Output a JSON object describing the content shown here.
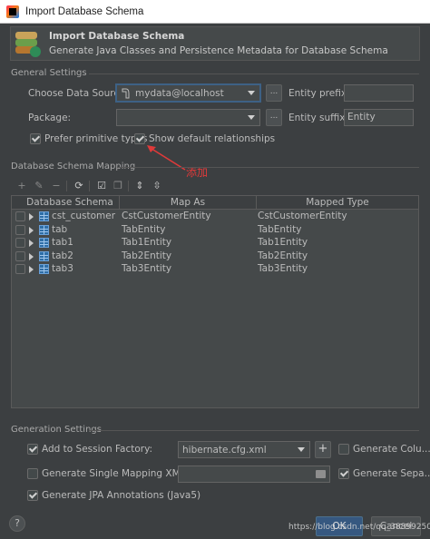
{
  "window": {
    "title": "Import Database Schema"
  },
  "banner": {
    "title": "Import Database Schema",
    "subtitle": "Generate Java Classes and Persistence Metadata for Database Schema"
  },
  "general": {
    "section_label": "General Settings",
    "datasource_label": "Choose Data Source:",
    "datasource_value": "mydata@localhost",
    "package_label": "Package:",
    "package_value": "",
    "browse_label": "...",
    "entity_prefix_label": "Entity prefix:",
    "entity_prefix_value": "",
    "entity_suffix_label": "Entity suffix:",
    "entity_suffix_value": "Entity",
    "prefer_primitive_label": "Prefer primitive types",
    "prefer_primitive_checked": true,
    "show_default_rel_label": "Show default relationships",
    "show_default_rel_checked": true
  },
  "annotation": {
    "text": "添加",
    "color": "#e03a3a"
  },
  "mapping": {
    "section_label": "Database Schema Mapping",
    "toolbar": [
      "add-icon",
      "edit-icon",
      "remove-icon",
      "refresh-icon",
      "check-all-icon",
      "copy-icon",
      "expand-all-icon",
      "collapse-all-icon"
    ],
    "columns": [
      "Database Schema",
      "Map As",
      "Mapped Type"
    ],
    "rows": [
      {
        "schema": "cst_customer",
        "map_as": "CstCustomerEntity",
        "mapped_type": "CstCustomerEntity"
      },
      {
        "schema": "tab",
        "map_as": "TabEntity",
        "mapped_type": "TabEntity"
      },
      {
        "schema": "tab1",
        "map_as": "Tab1Entity",
        "mapped_type": "Tab1Entity"
      },
      {
        "schema": "tab2",
        "map_as": "Tab2Entity",
        "mapped_type": "Tab2Entity"
      },
      {
        "schema": "tab3",
        "map_as": "Tab3Entity",
        "mapped_type": "Tab3Entity"
      }
    ]
  },
  "generation": {
    "section_label": "Generation Settings",
    "add_session_label": "Add to Session Factory:",
    "add_session_checked": true,
    "session_factory_value": "hibernate.cfg.xml",
    "add_button": "+",
    "generate_columns_label": "Generate Colu...",
    "generate_columns_checked": false,
    "single_mapping_label": "Generate Single Mapping XML:",
    "single_mapping_checked": false,
    "single_mapping_value": "",
    "generate_separate_label": "Generate Sepa...",
    "generate_separate_checked": true,
    "jpa_label": "Generate JPA Annotations (Java5)",
    "jpa_checked": true
  },
  "footer": {
    "help": "?",
    "ok": "OK",
    "cancel": "Cancel",
    "watermark": "https://blog.csdn.net/qq_38899250"
  }
}
